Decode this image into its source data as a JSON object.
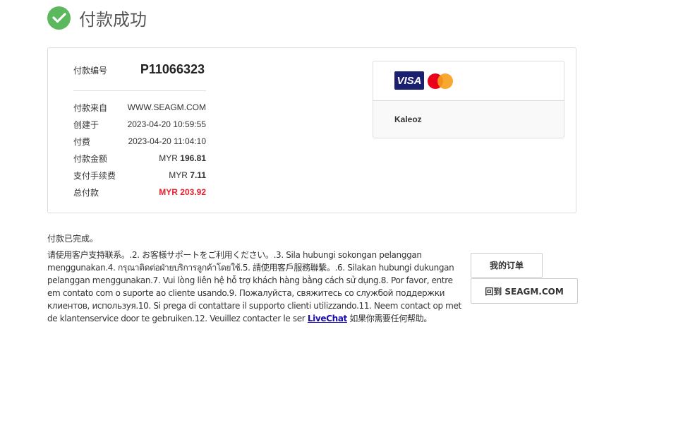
{
  "header": {
    "title": "付款成功",
    "icon": "check-circle-icon",
    "icon_color": "#5cb85c"
  },
  "summary": {
    "payment_no_label": "付款编号",
    "payment_no": "P11066323",
    "rows": [
      {
        "label": "付款来自",
        "value": "WWW.SEAGM.COM"
      },
      {
        "label": "创建于",
        "value": "2023-04-20 10:59:55"
      },
      {
        "label": "付费",
        "value": "2023-04-20 11:04:10"
      },
      {
        "label": "付款金额",
        "currency": "MYR",
        "amount": "196.81"
      },
      {
        "label": "支付手续费",
        "currency": "MYR",
        "amount": "7.11"
      },
      {
        "label": "总付款",
        "total": "MYR 203.92"
      }
    ]
  },
  "payment_method": {
    "visa_text": "VISA",
    "name": "Kaleoz"
  },
  "status_text": "付款已完成。",
  "help": {
    "text_before": "请使用客户支持联系。.2. お客様サポートをご利用ください。.3. Sila hubungi sokongan pelanggan menggunakan.4. กรุณาติดต่อฝ่ายบริการลูกค้าโดยใช้.5. 請使用客戶服務聯繫。.6. Silakan hubungi dukungan pelanggan menggunakan.7. Vui lòng liên hệ hỗ trợ khách hàng bằng cách sử dụng.8. Por favor, entre em contato com o suporte ao cliente usando.9. Пожалуйста, свяжитесь со службой поддержки клиентов, используя.10. Si prega di contattare il supporto clienti utilizzando.11. Neem contact op met de klantenservice door te gebruiken.12. Veuillez contacter le ser ",
    "link_text": "LiveChat",
    "text_after": " 如果你需要任何帮助。"
  },
  "buttons": {
    "my_orders": "我的订单",
    "back_home": "回到 SEAGM.COM"
  },
  "colors": {
    "accent_red": "#e8202e",
    "link": "#1a0dab"
  }
}
